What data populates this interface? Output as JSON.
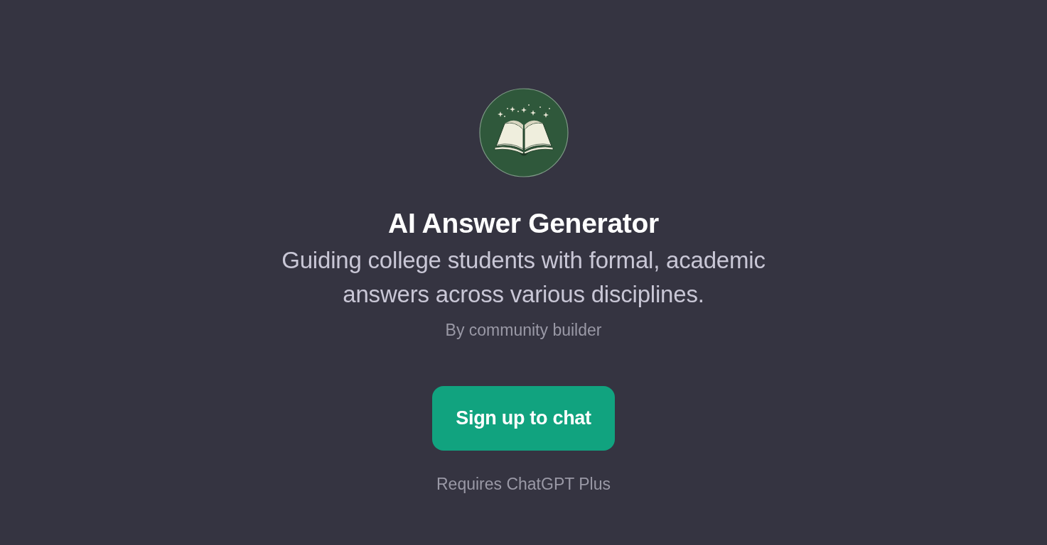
{
  "gpt": {
    "title": "AI Answer Generator",
    "description": "Guiding college students with formal, academic answers across various disciplines.",
    "author": "By community builder"
  },
  "cta": {
    "label": "Sign up to chat",
    "note": "Requires ChatGPT Plus"
  }
}
